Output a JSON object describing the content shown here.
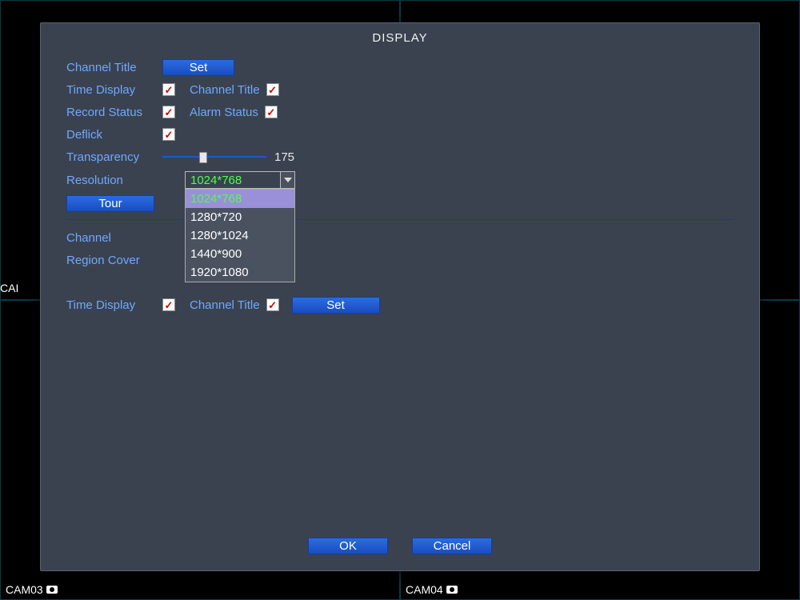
{
  "background": {
    "cam_side_left": "CAI",
    "cam_left_partial": "CA",
    "cam03": "CAM03",
    "cam04": "CAM04"
  },
  "dialog": {
    "title": "DISPLAY",
    "channel_title_label": "Channel Title",
    "set_label": "Set",
    "time_display_label": "Time Display",
    "channel_title_cb_label": "Channel Title",
    "record_status_label": "Record Status",
    "alarm_status_label": "Alarm Status",
    "deflick_label": "Deflick",
    "transparency_label": "Transparency",
    "transparency_value": "175",
    "resolution_label": "Resolution",
    "resolution_selected": "1024*768",
    "resolution_options": [
      "1024*768",
      "1280*720",
      "1280*1024",
      "1440*900",
      "1920*1080"
    ],
    "tour_label": "Tour",
    "channel_label": "Channel",
    "region_cover_label": "Region Cover",
    "time_display2_label": "Time Display",
    "channel_title2_label": "Channel Title",
    "set2_label": "Set",
    "ok_label": "OK",
    "cancel_label": "Cancel",
    "checkboxes": {
      "time_display": true,
      "channel_title": true,
      "record_status": true,
      "alarm_status": true,
      "deflick": true,
      "time_display2": true,
      "channel_title2": true
    }
  }
}
